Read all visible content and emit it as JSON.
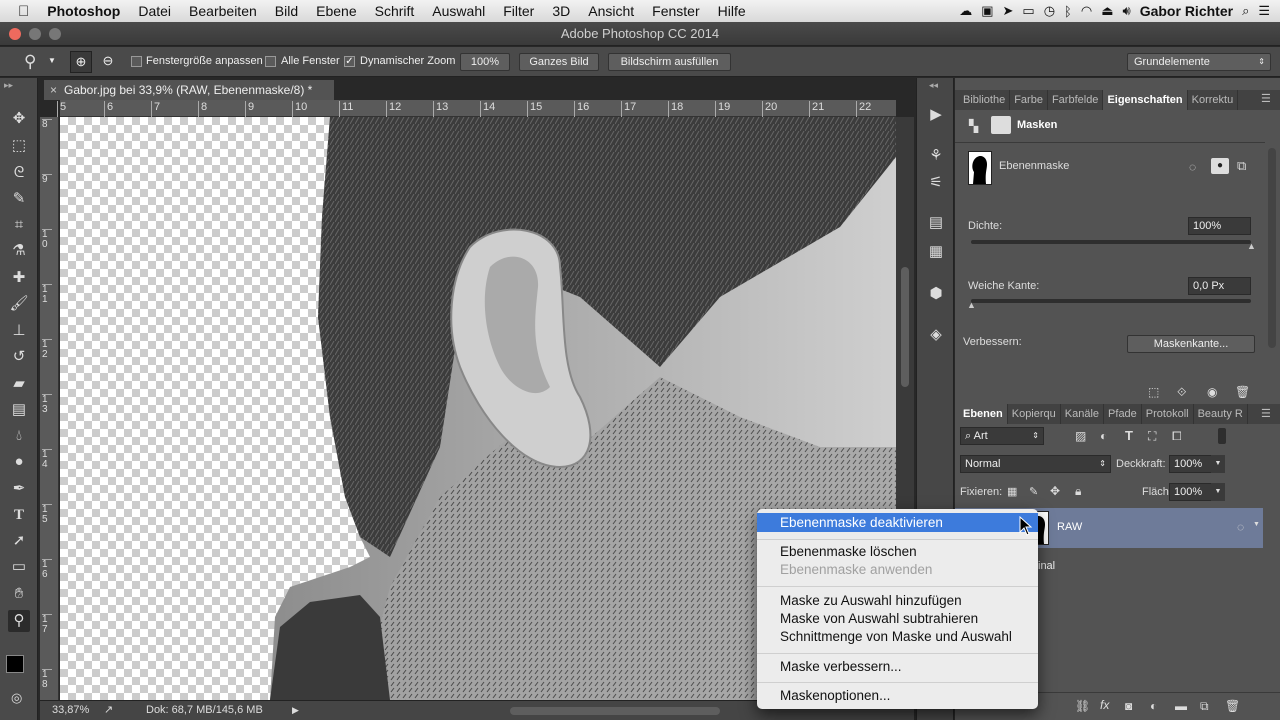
{
  "menubar": {
    "apple_glyph": "",
    "app_name": "Photoshop",
    "items": [
      "Datei",
      "Bearbeiten",
      "Bild",
      "Ebene",
      "Schrift",
      "Auswahl",
      "Filter",
      "3D",
      "Ansicht",
      "Fenster",
      "Hilfe"
    ],
    "user": "Gabor Richter"
  },
  "window": {
    "title": "Adobe Photoshop CC 2014"
  },
  "options": {
    "fit_window": "Fenstergröße anpassen",
    "all_windows": "Alle Fenster",
    "dynamic_zoom": "Dynamischer Zoom",
    "zoom_100": "100%",
    "whole_image": "Ganzes Bild",
    "fill_screen": "Bildschirm ausfüllen",
    "workspace": "Grundelemente"
  },
  "document": {
    "tab_title": "Gabor.jpg bei 33,9% (RAW, Ebenenmaske/8) *",
    "ruler_h": [
      "5",
      "6",
      "7",
      "8",
      "9",
      "10",
      "11",
      "12",
      "13",
      "14",
      "15",
      "16",
      "17",
      "18",
      "19",
      "20",
      "21",
      "22"
    ],
    "ruler_v": [
      "8",
      "9",
      "10",
      "11",
      "12",
      "13",
      "14",
      "15",
      "16",
      "17",
      "18"
    ],
    "zoom": "33,87%",
    "doc_size": "Dok: 68,7 MB/145,6 MB"
  },
  "properties": {
    "tabs": [
      "Bibliothe",
      "Farbe",
      "Farbfelde",
      "Eigenschaften",
      "Korrektu"
    ],
    "header": "Masken",
    "mask_label": "Ebenenmaske",
    "density_label": "Dichte:",
    "density_value": "100%",
    "density": 1.0,
    "feather_label": "Weiche Kante:",
    "feather_value": "0,0 Px",
    "feather": 0.0,
    "refine_label": "Verbessern:",
    "mask_edge_button": "Maskenkante..."
  },
  "layers": {
    "tabs": [
      "Ebenen",
      "Kopierqu",
      "Kanäle",
      "Pfade",
      "Protokoll",
      "Beauty R"
    ],
    "filter": "Art",
    "blend_mode": "Normal",
    "opacity_label": "Deckkraft:",
    "opacity_value": "100%",
    "lock_label": "Fixieren:",
    "fill_label": "Fläche:",
    "fill_value": "100%",
    "layer1_name": "RAW",
    "layer2_name": "inal"
  },
  "context_menu": {
    "item1": "Ebenenmaske deaktivieren",
    "item2": "Ebenenmaske löschen",
    "item3": "Ebenenmaske anwenden",
    "item4": "Maske zu Auswahl hinzufügen",
    "item5": "Maske von Auswahl subtrahieren",
    "item6": "Schnittmenge von Maske und Auswahl",
    "item7": "Maske verbessern...",
    "item8": "Maskenoptionen..."
  },
  "colors": {
    "accent": "#3d7bdc",
    "panel": "#535353",
    "selected_layer": "#6e7b99"
  }
}
